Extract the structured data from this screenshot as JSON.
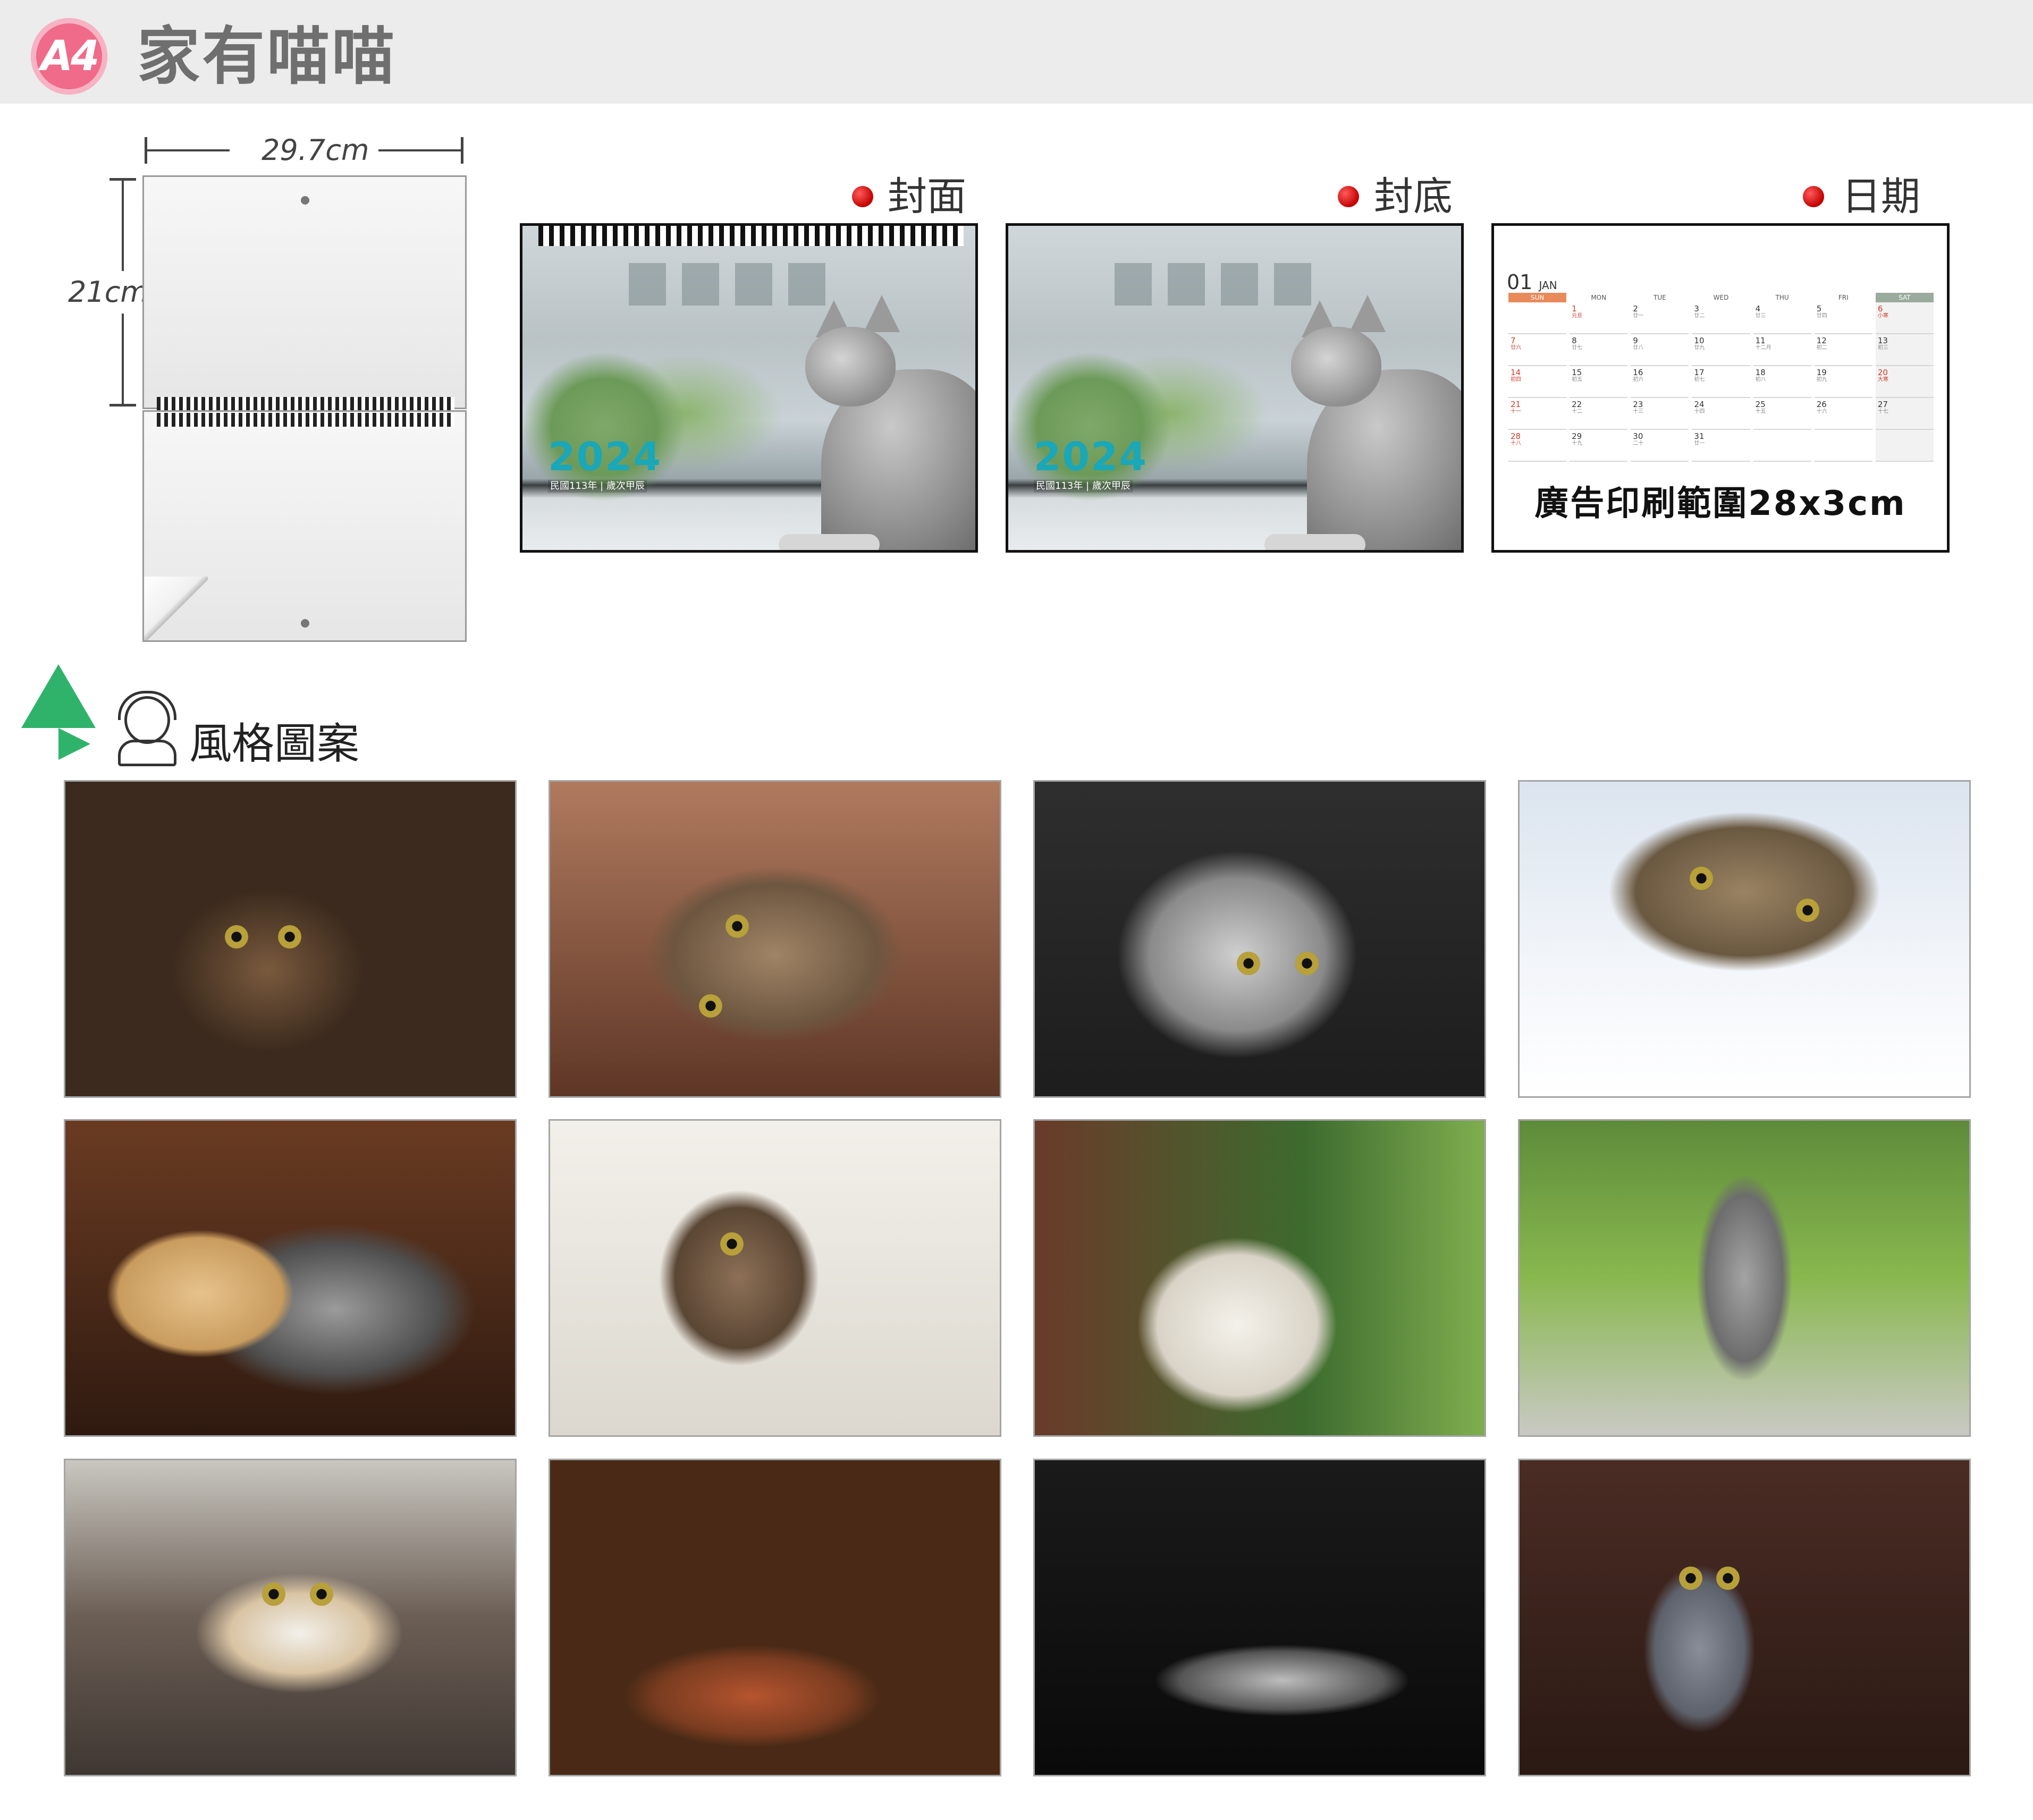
{
  "header": {
    "badge": "A4",
    "title": "家有喵喵"
  },
  "size": {
    "width_label": "29.7cm",
    "height_label": "21cm"
  },
  "panels": {
    "cover_label": "封面",
    "back_label": "封底",
    "date_label": "日期"
  },
  "cover": {
    "year": "2024",
    "subtitle": "民國113年 | 歲次甲辰"
  },
  "calendar": {
    "month_num": "01",
    "month_name": "JAN",
    "weekdays": [
      "SUN",
      "MON",
      "TUE",
      "WED",
      "THU",
      "FRI",
      "SAT"
    ],
    "weeks": [
      [
        [
          "",
          ""
        ],
        [
          "1",
          "元旦"
        ],
        [
          "2",
          "廿一"
        ],
        [
          "3",
          "廿二"
        ],
        [
          "4",
          "廿三"
        ],
        [
          "5",
          "廿四"
        ],
        [
          "6",
          "小寒"
        ]
      ],
      [
        [
          "7",
          "廿六"
        ],
        [
          "8",
          "廿七"
        ],
        [
          "9",
          "廿八"
        ],
        [
          "10",
          "廿九"
        ],
        [
          "11",
          "十二月"
        ],
        [
          "12",
          "初二"
        ],
        [
          "13",
          "初三"
        ]
      ],
      [
        [
          "14",
          "初四"
        ],
        [
          "15",
          "初五"
        ],
        [
          "16",
          "初六"
        ],
        [
          "17",
          "初七"
        ],
        [
          "18",
          "初八"
        ],
        [
          "19",
          "初九"
        ],
        [
          "20",
          "大寒"
        ]
      ],
      [
        [
          "21",
          "十一"
        ],
        [
          "22",
          "十二"
        ],
        [
          "23",
          "十三"
        ],
        [
          "24",
          "十四"
        ],
        [
          "25",
          "十五"
        ],
        [
          "26",
          "十六"
        ],
        [
          "27",
          "十七"
        ]
      ],
      [
        [
          "28",
          "十八"
        ],
        [
          "29",
          "十九"
        ],
        [
          "30",
          "二十"
        ],
        [
          "31",
          "廿一"
        ],
        [
          "",
          ""
        ],
        [
          "",
          ""
        ],
        [
          "",
          ""
        ]
      ]
    ],
    "ad_text": "廣告印刷範圍28x3cm"
  },
  "style_section": {
    "title": "風格圖案"
  },
  "colors": {
    "accent_teal": "#1aa7b8",
    "badge_pink": "#f06a8a",
    "dot_red": "#c20000",
    "leaf_green": "#2fb36b"
  }
}
